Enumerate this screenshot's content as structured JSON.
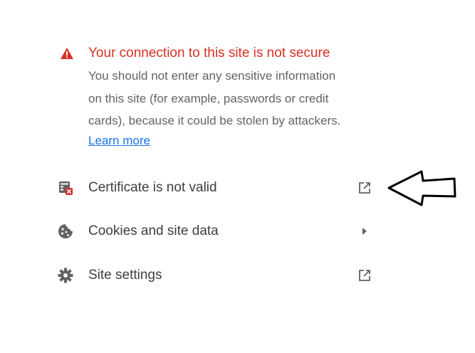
{
  "warning": {
    "icon": "warning-triangle-icon",
    "color": "#d93025",
    "title": "Your connection to this site is not secure",
    "body_lines": [
      "You should not enter any sensitive information",
      "on this site (for example, passwords or credit",
      "cards), because it could be stolen by attackers."
    ],
    "learn_more": "Learn more"
  },
  "rows": [
    {
      "label": "Certificate is not valid",
      "icon": "certificate-error-icon",
      "trailing_icon": "open-external-icon"
    },
    {
      "label": "Cookies and site data",
      "icon": "cookie-icon",
      "trailing_icon": "submenu-arrow-icon"
    },
    {
      "label": "Site settings",
      "icon": "gear-icon",
      "trailing_icon": "open-external-icon"
    }
  ],
  "colors": {
    "text_primary": "#3c4043",
    "text_secondary": "#5f6368",
    "link": "#1a73e8",
    "icon": "#5f6368"
  }
}
